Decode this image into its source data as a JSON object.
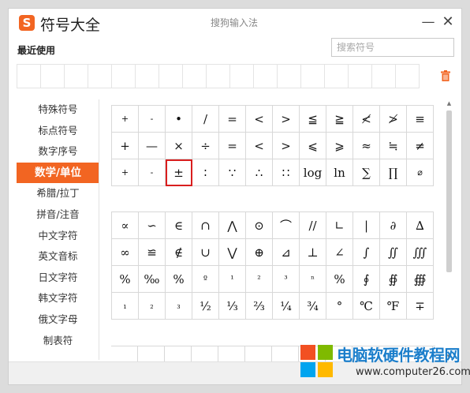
{
  "window": {
    "title": "符号大全",
    "ime_title": "搜狗输入法",
    "logo_char": "S",
    "min_glyph": "—",
    "close_glyph": "✕"
  },
  "recent": {
    "label": "最近使用",
    "cells": 17
  },
  "search": {
    "placeholder": "搜索符号",
    "value": ""
  },
  "sidebar": {
    "items": [
      {
        "label": "特殊符号"
      },
      {
        "label": "标点符号"
      },
      {
        "label": "数字序号"
      },
      {
        "label": "数学/单位",
        "active": true
      },
      {
        "label": "希腊/拉丁"
      },
      {
        "label": "拼音/注音"
      },
      {
        "label": "中文字符"
      },
      {
        "label": "英文音标"
      },
      {
        "label": "日文字符"
      },
      {
        "label": "韩文字符"
      },
      {
        "label": "俄文字母"
      },
      {
        "label": "制表符"
      }
    ]
  },
  "grid1": [
    [
      "+",
      "-",
      "•",
      "/",
      "=",
      "<",
      ">",
      "≦",
      "≧",
      "≮",
      "≯",
      "≡"
    ],
    [
      "+",
      "—",
      "×",
      "÷",
      "=",
      "<",
      ">",
      "⩽",
      "⩾",
      "≈",
      "≒",
      "≠"
    ],
    [
      "+",
      "-",
      "±",
      "∶",
      "∵",
      "∴",
      "∷",
      "log",
      "ln",
      "∑",
      "∏",
      "⌀"
    ]
  ],
  "grid1_small": [
    [
      true,
      true,
      false,
      false,
      false,
      false,
      false,
      false,
      false,
      false,
      false,
      false
    ],
    [
      false,
      false,
      false,
      false,
      false,
      false,
      false,
      false,
      false,
      false,
      false,
      false
    ],
    [
      true,
      true,
      false,
      false,
      false,
      false,
      false,
      false,
      false,
      false,
      false,
      true
    ]
  ],
  "highlight": {
    "row": 2,
    "col": 2,
    "color": "#d91e1e"
  },
  "grid2": [
    [
      "∝",
      "∽",
      "∈",
      "∩",
      "⋀",
      "⊙",
      "⌒",
      "//",
      "∟",
      "|",
      "∂",
      "∆"
    ],
    [
      "∞",
      "≌",
      "∉",
      "∪",
      "⋁",
      "⊕",
      "⊿",
      "⊥",
      "∠",
      "∫",
      "∬",
      "∭"
    ],
    [
      "%",
      "‰",
      "%",
      "º",
      "¹",
      "²",
      "³",
      "ⁿ",
      "%",
      "∮",
      "∯",
      "∰"
    ],
    [
      "₁",
      "₂",
      "₃",
      "½",
      "⅓",
      "⅔",
      "¼",
      "¾",
      "°",
      "℃",
      "℉",
      "∓"
    ]
  ],
  "grid2_small": [
    [
      false,
      false,
      false,
      false,
      false,
      false,
      false,
      false,
      false,
      false,
      false,
      false
    ],
    [
      false,
      false,
      false,
      false,
      false,
      false,
      false,
      false,
      false,
      false,
      false,
      false
    ],
    [
      false,
      false,
      false,
      true,
      true,
      true,
      true,
      true,
      false,
      false,
      false,
      false
    ],
    [
      true,
      true,
      true,
      false,
      false,
      false,
      false,
      false,
      false,
      false,
      false,
      false
    ]
  ],
  "colors": {
    "accent": "#f26522",
    "highlight": "#d91e1e",
    "watermark_blue": "#1b7ecb"
  },
  "watermark": {
    "title": "电脑软硬件教程网",
    "url": "www.computer26.com"
  }
}
